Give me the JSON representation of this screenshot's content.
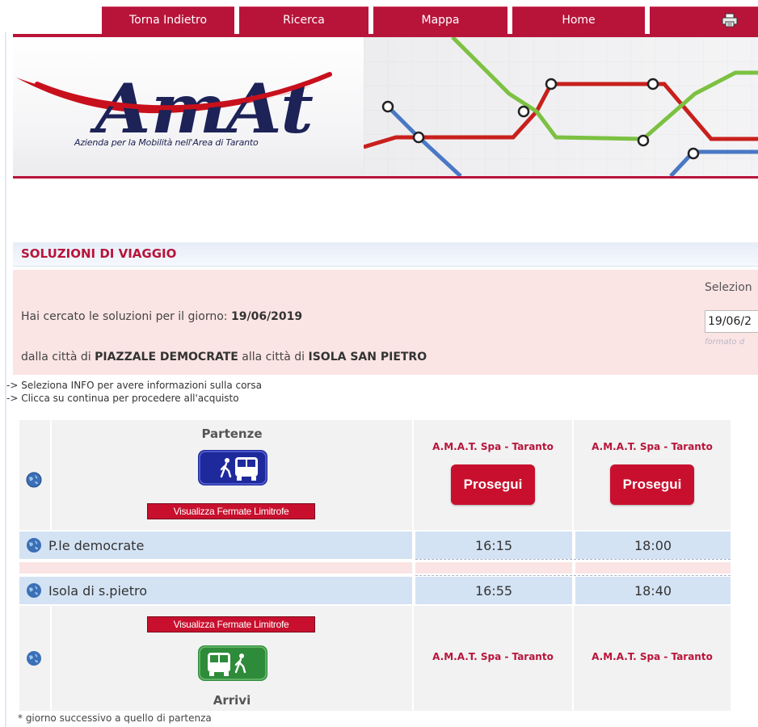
{
  "nav": {
    "back": "Torna Indietro",
    "search": "Ricerca",
    "map": "Mappa",
    "home": "Home",
    "print_icon": "printer-icon"
  },
  "banner": {
    "logo_text": "AmAt",
    "tagline": "Azienda per la Mobilità nell'Area di Taranto",
    "map_line_colors": {
      "red": "#c8201c",
      "green": "#7cc142",
      "blue": "#4a78c4"
    }
  },
  "section_title": "SOLUZIONI DI VIAGGIO",
  "search_info": {
    "line1_prefix": "Hai cercato le soluzioni per il giorno: ",
    "date": "19/06/2019",
    "line2_a": "dalla città di ",
    "from_city": "PIAZZALE DEMOCRATE",
    "line2_b": " alla città di ",
    "to_city": "ISOLA SAN PIETRO",
    "select_label": "Selezion",
    "date_input_value": "19/06/2",
    "date_hint": "formato d"
  },
  "hints": [
    "-> Seleziona INFO per avere informazioni sulla corsa",
    "-> Clicca su continua per procedere all'acquisto"
  ],
  "table": {
    "departures_label": "Partenze",
    "arrivals_label": "Arrivi",
    "nearby_stops_button": "Visualizza Fermate Limitrofe",
    "proceed_button": "Prosegui",
    "runs": [
      {
        "company_top": "A.M.A.T. Spa - Taranto",
        "company_bottom": "A.M.A.T. Spa - Taranto",
        "dep_time": "16:15",
        "arr_time": "16:55"
      },
      {
        "company_top": "A.M.A.T. Spa - Taranto",
        "company_bottom": "A.M.A.T. Spa - Taranto",
        "dep_time": "18:00",
        "arr_time": "18:40"
      }
    ],
    "stops": {
      "departure": "P.le democrate",
      "arrival": "Isola di s.pietro"
    },
    "colors": {
      "accent": "#c8102e",
      "departures_icon": "#1e2a9c",
      "arrivals_icon": "#2e8b3a"
    }
  },
  "footnote": "* giorno successivo a quello di partenza"
}
